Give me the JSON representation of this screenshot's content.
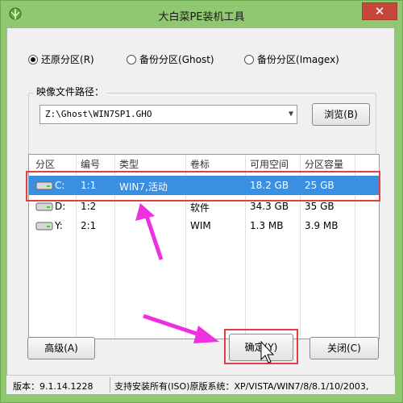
{
  "window": {
    "title": "大白菜PE装机工具",
    "close_glyph": "✕"
  },
  "modes": [
    {
      "label": "还原分区",
      "hotkey": "(R)",
      "selected": true
    },
    {
      "label": "备份分区",
      "hotkey": "(Ghost)",
      "selected": false
    },
    {
      "label": "备份分区",
      "hotkey": "(Imagex)",
      "selected": false
    }
  ],
  "image_path": {
    "label": "映像文件路径：",
    "value": "Z:\\Ghost\\WIN7SP1.GHO",
    "browse": "浏览(B)"
  },
  "table": {
    "headers": [
      "分区",
      "编号",
      "类型",
      "卷标",
      "可用空间",
      "分区容量"
    ],
    "rows": [
      {
        "drive": "C:",
        "num": "1:1",
        "type": "WIN7,活动",
        "label": "",
        "free": "18.2 GB",
        "size": "25 GB",
        "selected": true
      },
      {
        "drive": "D:",
        "num": "1:2",
        "type": "",
        "label": "软件",
        "free": "34.3 GB",
        "size": "35 GB",
        "selected": false
      },
      {
        "drive": "Y:",
        "num": "2:1",
        "type": "",
        "label": "WIM",
        "free": "1.3 MB",
        "size": "3.9 MB",
        "selected": false
      }
    ]
  },
  "buttons": {
    "advanced": "高级(A)",
    "ok": "确定(Y)",
    "close": "关闭(C)"
  },
  "status": {
    "version": "版本：9.1.14.1228",
    "support": "支持安装所有(ISO)原版系统：XP/VISTA/WIN7/8/8.1/10/2003,"
  },
  "colors": {
    "accent_select": "#3b8fe0",
    "highlight": "#e04040",
    "arrow": "#f030e0",
    "frame": "#8fc870"
  },
  "icons": {
    "app": "cabbage-icon",
    "drive": "hard-drive-icon",
    "cursor": "mouse-cursor-icon"
  }
}
